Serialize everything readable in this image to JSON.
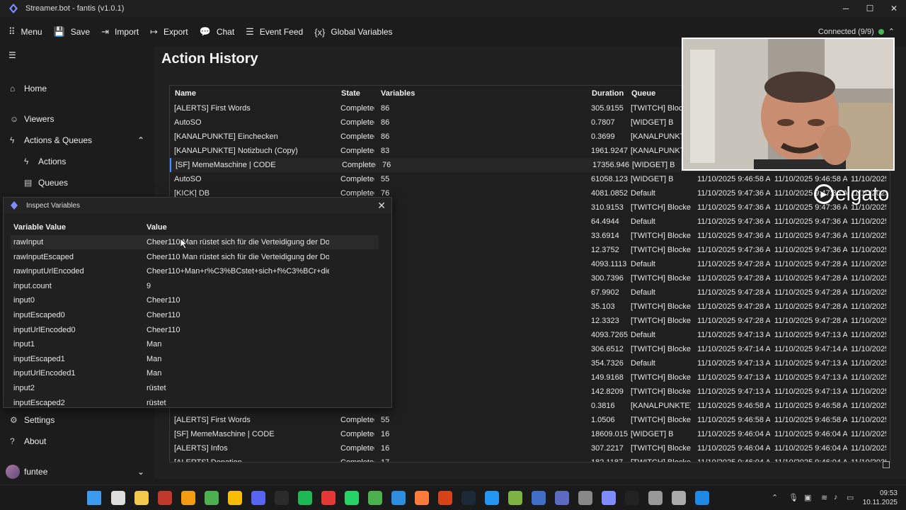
{
  "window": {
    "title": "Streamer.bot - fantis (v1.0.1)",
    "min": "─",
    "max": "☐",
    "close": "✕"
  },
  "toolbar": {
    "items": [
      {
        "icon": "grid-icon",
        "glyph": "⠿",
        "label": "Menu"
      },
      {
        "icon": "save-icon",
        "glyph": "💾",
        "label": "Save"
      },
      {
        "icon": "import-icon",
        "glyph": "⇥",
        "label": "Import"
      },
      {
        "icon": "export-icon",
        "glyph": "↦",
        "label": "Export"
      },
      {
        "icon": "chat-icon",
        "glyph": "💬",
        "label": "Chat"
      },
      {
        "icon": "event-feed-icon",
        "glyph": "☰",
        "label": "Event Feed"
      },
      {
        "icon": "variables-icon",
        "glyph": "{x}",
        "label": "Global Variables"
      }
    ],
    "status": "Connected (9/9)",
    "status_color": "#3fb950"
  },
  "sidebar": {
    "hamburger": "☰",
    "items": [
      {
        "label": "Home",
        "glyph": "⌂"
      },
      {
        "label": "Viewers",
        "glyph": "☺"
      },
      {
        "label": "Actions & Queues",
        "glyph": "ϟ",
        "chevron": "⌃"
      },
      {
        "label": "Actions",
        "glyph": "ϟ"
      },
      {
        "label": "Queues",
        "glyph": "▤"
      },
      {
        "label": "Settings",
        "glyph": "⚙"
      },
      {
        "label": "About",
        "glyph": "?"
      }
    ],
    "user": {
      "name": "funtee",
      "chevron": "⌄"
    }
  },
  "page": {
    "title": "Action History"
  },
  "grid": {
    "columns": {
      "name": "Name",
      "state": "State",
      "variables": "Variables",
      "duration": "Duration",
      "queue": "Queue"
    },
    "rows": [
      {
        "name": "[ALERTS] First Words",
        "state": "Completed",
        "vars": "86",
        "dur": "305.9155",
        "queue": "[TWITCH] Blocked",
        "t1": "",
        "t2": "",
        "t3": ""
      },
      {
        "name": "AutoSO",
        "state": "Completed",
        "vars": "86",
        "dur": "0.7807",
        "queue": "[WIDGET] B",
        "t1": "",
        "t2": "",
        "t3": ""
      },
      {
        "name": "[KANALPUNKTE] Einchecken",
        "state": "Completed",
        "vars": "86",
        "dur": "0.3699",
        "queue": "[KANALPUNKTE]",
        "t1": "",
        "t2": "",
        "t3": ""
      },
      {
        "name": "[KANALPUNKTE] Notizbuch (Copy)",
        "state": "Completed",
        "vars": "83",
        "dur": "1961.9247",
        "queue": "[KANALPUNKTE]",
        "t1": "",
        "t2": "",
        "t3": ""
      },
      {
        "name": "[SF] MemeMaschine | CODE",
        "state": "Completed",
        "vars": "76",
        "dur": "17356.946",
        "queue": "[WIDGET] B",
        "t1": "",
        "t2": "",
        "t3": ""
      },
      {
        "name": "AutoSO",
        "state": "Completed",
        "vars": "55",
        "dur": "61058.123",
        "queue": "[WIDGET] B",
        "t1": "11/10/2025 9:46:58 A",
        "t2": "11/10/2025 9:46:58 A",
        "t3": "11/10/2025"
      },
      {
        "name": "[KICK] DB",
        "state": "Completed",
        "vars": "76",
        "dur": "4081.0852",
        "queue": "Default",
        "t1": "11/10/2025 9:47:36 A",
        "t2": "11/10/2025 9:47:36 A",
        "t3": "11/10/2025"
      },
      {
        "name": "",
        "state": "",
        "vars": "",
        "dur": "310.9153",
        "queue": "[TWITCH] Blocked",
        "t1": "11/10/2025 9:47:36 A",
        "t2": "11/10/2025 9:47:36 A",
        "t3": "11/10/2025"
      },
      {
        "name": "",
        "state": "",
        "vars": "",
        "dur": "64.4944",
        "queue": "Default",
        "t1": "11/10/2025 9:47:36 A",
        "t2": "11/10/2025 9:47:36 A",
        "t3": "11/10/2025"
      },
      {
        "name": "",
        "state": "",
        "vars": "",
        "dur": "33.6914",
        "queue": "[TWITCH] Blocked",
        "t1": "11/10/2025 9:47:36 A",
        "t2": "11/10/2025 9:47:36 A",
        "t3": "11/10/2025"
      },
      {
        "name": "",
        "state": "",
        "vars": "",
        "dur": "12.3752",
        "queue": "[TWITCH] Blocked",
        "t1": "11/10/2025 9:47:36 A",
        "t2": "11/10/2025 9:47:36 A",
        "t3": "11/10/2025"
      },
      {
        "name": "",
        "state": "",
        "vars": "",
        "dur": "4093.1113",
        "queue": "Default",
        "t1": "11/10/2025 9:47:28 A",
        "t2": "11/10/2025 9:47:28 A",
        "t3": "11/10/2025"
      },
      {
        "name": "",
        "state": "",
        "vars": "",
        "dur": "300.7396",
        "queue": "[TWITCH] Blocked",
        "t1": "11/10/2025 9:47:28 A",
        "t2": "11/10/2025 9:47:28 A",
        "t3": "11/10/2025"
      },
      {
        "name": "",
        "state": "",
        "vars": "",
        "dur": "67.9902",
        "queue": "Default",
        "t1": "11/10/2025 9:47:28 A",
        "t2": "11/10/2025 9:47:28 A",
        "t3": "11/10/2025"
      },
      {
        "name": "",
        "state": "",
        "vars": "",
        "dur": "35.103",
        "queue": "[TWITCH] Blocked",
        "t1": "11/10/2025 9:47:28 A",
        "t2": "11/10/2025 9:47:28 A",
        "t3": "11/10/2025"
      },
      {
        "name": "",
        "state": "",
        "vars": "",
        "dur": "12.3323",
        "queue": "[TWITCH] Blocked",
        "t1": "11/10/2025 9:47:28 A",
        "t2": "11/10/2025 9:47:28 A",
        "t3": "11/10/2025"
      },
      {
        "name": "",
        "state": "",
        "vars": "",
        "dur": "4093.7265",
        "queue": "Default",
        "t1": "11/10/2025 9:47:13 A",
        "t2": "11/10/2025 9:47:13 A",
        "t3": "11/10/2025"
      },
      {
        "name": "",
        "state": "",
        "vars": "",
        "dur": "306.6512",
        "queue": "[TWITCH] Blocked",
        "t1": "11/10/2025 9:47:14 A",
        "t2": "11/10/2025 9:47:14 A",
        "t3": "11/10/2025"
      },
      {
        "name": "",
        "state": "",
        "vars": "",
        "dur": "354.7326",
        "queue": "Default",
        "t1": "11/10/2025 9:47:13 A",
        "t2": "11/10/2025 9:47:13 A",
        "t3": "11/10/2025"
      },
      {
        "name": "",
        "state": "",
        "vars": "",
        "dur": "149.9168",
        "queue": "[TWITCH] Blocked",
        "t1": "11/10/2025 9:47:13 A",
        "t2": "11/10/2025 9:47:13 A",
        "t3": "11/10/2025"
      },
      {
        "name": "",
        "state": "",
        "vars": "",
        "dur": "142.8209",
        "queue": "[TWITCH] Blocked",
        "t1": "11/10/2025 9:47:13 A",
        "t2": "11/10/2025 9:47:13 A",
        "t3": "11/10/2025"
      },
      {
        "name": "",
        "state": "",
        "vars": "",
        "dur": "0.3816",
        "queue": "[KANALPUNKTE] In",
        "t1": "11/10/2025 9:46:58 A",
        "t2": "11/10/2025 9:46:58 A",
        "t3": "11/10/2025"
      },
      {
        "name": "[ALERTS] First Words",
        "state": "Completed",
        "vars": "55",
        "dur": "1.0506",
        "queue": "[TWITCH] Blocked",
        "t1": "11/10/2025 9:46:58 A",
        "t2": "11/10/2025 9:46:58 A",
        "t3": "11/10/2025"
      },
      {
        "name": "[SF] MemeMaschine | CODE",
        "state": "Completed",
        "vars": "16",
        "dur": "18609.015",
        "queue": "[WIDGET] B",
        "t1": "11/10/2025 9:46:04 A",
        "t2": "11/10/2025 9:46:04 A",
        "t3": "11/10/2025"
      },
      {
        "name": "[ALERTS] Infos",
        "state": "Completed",
        "vars": "16",
        "dur": "307.2217",
        "queue": "[TWITCH] Blocked",
        "t1": "11/10/2025 9:46:04 A",
        "t2": "11/10/2025 9:46:04 A",
        "t3": "11/10/2025"
      },
      {
        "name": "[ALERTS] Donation",
        "state": "Completed",
        "vars": "17",
        "dur": "182.1187",
        "queue": "[TWITCH] Blocked",
        "t1": "11/10/2025 9:46:04 A",
        "t2": "11/10/2025 9:46:04 A",
        "t3": "11/10/2025"
      }
    ]
  },
  "overlay": {
    "brand": "elgato"
  },
  "dialog": {
    "title": "Inspect Variables",
    "close": "✕",
    "col_key": "Variable Value",
    "col_value": "Value",
    "rows": [
      {
        "k": "rawInput",
        "v": "Cheer110 Man rüstet sich für die Verteidigung der Dok"
      },
      {
        "k": "rawInputEscaped",
        "v": "Cheer110 Man rüstet sich für die Verteidigung der Dok"
      },
      {
        "k": "rawInputUrlEncoded",
        "v": "Cheer110+Man+r%C3%BCstet+sich+f%C3%BCr+die+V"
      },
      {
        "k": "input.count",
        "v": "9"
      },
      {
        "k": "input0",
        "v": "Cheer110"
      },
      {
        "k": "inputEscaped0",
        "v": "Cheer110"
      },
      {
        "k": "inputUrlEncoded0",
        "v": "Cheer110"
      },
      {
        "k": "input1",
        "v": "Man"
      },
      {
        "k": "inputEscaped1",
        "v": "Man"
      },
      {
        "k": "inputUrlEncoded1",
        "v": "Man"
      },
      {
        "k": "input2",
        "v": "rüstet"
      },
      {
        "k": "inputEscaped2",
        "v": "rüstet"
      }
    ]
  },
  "taskbar": {
    "apps": [
      {
        "name": "windows-start-icon",
        "color": "#3a9bf0"
      },
      {
        "name": "search-icon",
        "color": "#dddddd"
      },
      {
        "name": "file-explorer-icon",
        "color": "#f2c94c"
      },
      {
        "name": "filezilla-icon",
        "color": "#c0392b"
      },
      {
        "name": "vlc-icon",
        "color": "#f39c12"
      },
      {
        "name": "chrome-icon",
        "color": "#4caf50"
      },
      {
        "name": "chrome-icon",
        "color": "#fbbc04"
      },
      {
        "name": "discord-icon",
        "color": "#5865f2"
      },
      {
        "name": "epic-games-icon",
        "color": "#2b2b2b"
      },
      {
        "name": "spotify-icon",
        "color": "#1db954"
      },
      {
        "name": "app-icon",
        "color": "#e53935"
      },
      {
        "name": "whatsapp-icon",
        "color": "#25d366"
      },
      {
        "name": "notepad-icon",
        "color": "#4caf50"
      },
      {
        "name": "vscode-icon",
        "color": "#2d8ee0"
      },
      {
        "name": "app-icon",
        "color": "#ff7b39"
      },
      {
        "name": "app-icon",
        "color": "#d84315"
      },
      {
        "name": "steam-icon",
        "color": "#1b2838"
      },
      {
        "name": "app-icon",
        "color": "#2196f3"
      },
      {
        "name": "app-icon",
        "color": "#7cb342"
      },
      {
        "name": "app-icon",
        "color": "#3f6fc8"
      },
      {
        "name": "app-icon",
        "color": "#5c6bc0"
      },
      {
        "name": "app-icon",
        "color": "#888888"
      },
      {
        "name": "streamerbot-icon",
        "color": "#7f8cff"
      },
      {
        "name": "davinci-icon",
        "color": "#222222"
      },
      {
        "name": "app-icon",
        "color": "#999999"
      },
      {
        "name": "settings-icon",
        "color": "#aaaaaa"
      },
      {
        "name": "app-icon",
        "color": "#1e88e5"
      }
    ],
    "time": "09:53",
    "date": "10.11.2025"
  }
}
